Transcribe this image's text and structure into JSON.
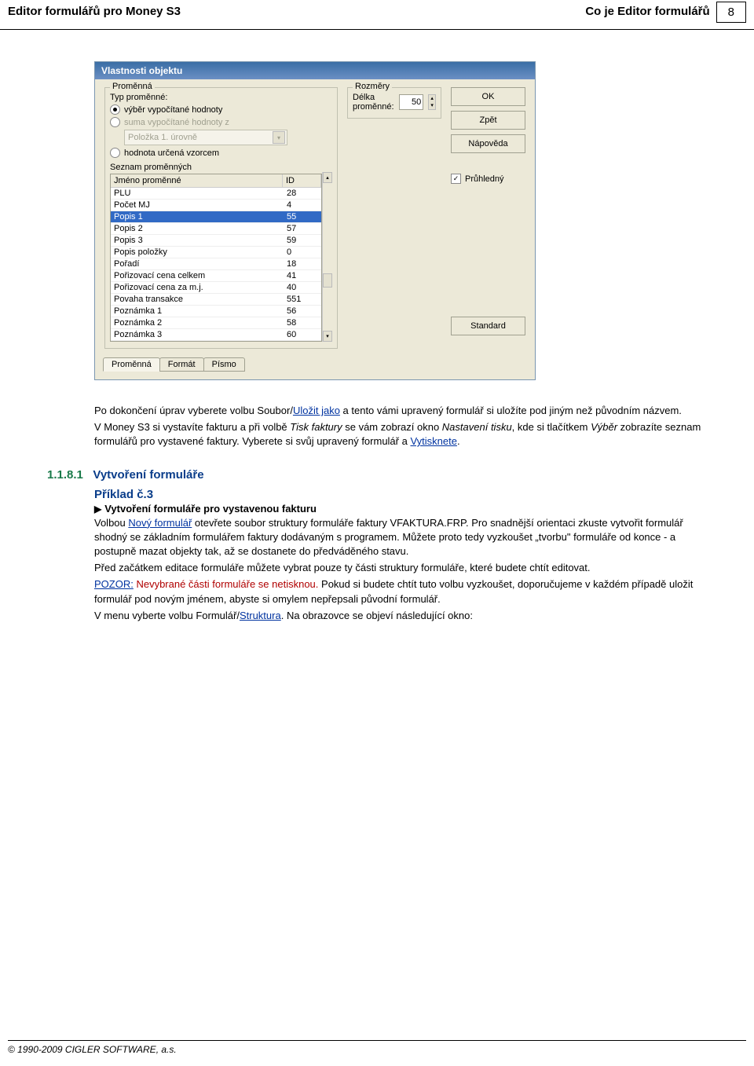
{
  "header": {
    "left": "Editor formulářů pro Money S3",
    "right": "Co je Editor formulářů",
    "page": "8"
  },
  "dialog": {
    "title": "Vlastnosti objektu",
    "group1_title": "Proměnná",
    "type_label": "Typ proměnné:",
    "radio1": "výběr vypočítané hodnoty",
    "radio2": "suma vypočítané hodnoty z",
    "combo_disabled": "Položka 1. úrovně",
    "radio3": "hodnota určená vzorcem",
    "list_title": "Seznam proměnných",
    "col_name": "Jméno proměnné",
    "col_id": "ID",
    "rows": [
      {
        "name": "PLU",
        "id": "28"
      },
      {
        "name": "Počet MJ",
        "id": "4"
      },
      {
        "name": "Popis 1",
        "id": "55",
        "sel": true
      },
      {
        "name": "Popis 2",
        "id": "57"
      },
      {
        "name": "Popis 3",
        "id": "59"
      },
      {
        "name": "Popis položky",
        "id": "0"
      },
      {
        "name": "Pořadí",
        "id": "18"
      },
      {
        "name": "Pořizovací cena celkem",
        "id": "41"
      },
      {
        "name": "Pořizovací cena za m.j.",
        "id": "40"
      },
      {
        "name": "Povaha transakce",
        "id": "551"
      },
      {
        "name": "Poznámka 1",
        "id": "56"
      },
      {
        "name": "Poznámka 2",
        "id": "58"
      },
      {
        "name": "Poznámka 3",
        "id": "60"
      }
    ],
    "group2_title": "Rozměry",
    "len_label": "Délka proměnné:",
    "len_value": "50",
    "btn_ok": "OK",
    "btn_back": "Zpět",
    "btn_help": "Nápověda",
    "chk_trans": "Průhledný",
    "btn_std": "Standard",
    "tab1": "Proměnná",
    "tab2": "Formát",
    "tab3": "Písmo"
  },
  "para1a": "Po dokončení úprav vyberete volbu Soubor/",
  "para1_link": "Uložit jako",
  "para1b": " a tento vámi upravený formulář si uložíte pod jiným než původním názvem.",
  "para2a": "V Money S3 si vystavíte fakturu a při volbě ",
  "para2_i1": "Tisk faktury",
  "para2b": " se vám zobrazí okno ",
  "para2_i2": "Nastavení tisku",
  "para2c": ", kde si tlačítkem ",
  "para2_i3": "Výběr ",
  "para2d": " zobrazíte seznam formulářů pro vystavené faktury. Vyberete si svůj upravený formulář a ",
  "para2_link": "Vytisknete",
  "para2e": ".",
  "section_num": "1.1.8.1",
  "section_title": "Vytvoření formuláře",
  "example_title": "Příklad č.3",
  "example_sub": "Vytvoření formuláře pro vystavenou fakturu",
  "p3a": "Volbou ",
  "p3_link": "Nový formulář",
  "p3b": " otevřete soubor struktury formuláře faktury VFAKTURA.FRP. Pro snadnější orientaci zkuste vytvořit formulář shodný se základním formulářem faktury dodávaným s programem. Můžete proto tedy vyzkoušet „tvorbu\" formuláře od konce - a postupně mazat objekty tak, až se dostanete do předváděného stavu.",
  "p4": "Před začátkem editace formuláře můžete vybrat pouze ty části struktury formuláře, které budete chtít editovat.",
  "p5a": "POZOR:",
  "p5b": " Nevybrané části formuláře se netisknou.",
  "p5c": " Pokud si budete chtít tuto volbu vyzkoušet, doporučujeme v každém případě uložit formulář pod novým jménem, abyste si omylem nepřepsali původní formulář.",
  "p6a": "V menu vyberte volbu Formulář/",
  "p6_link": "Struktura",
  "p6b": ". Na obrazovce se objeví následující okno:",
  "footer": "© 1990-2009 CIGLER SOFTWARE, a.s."
}
